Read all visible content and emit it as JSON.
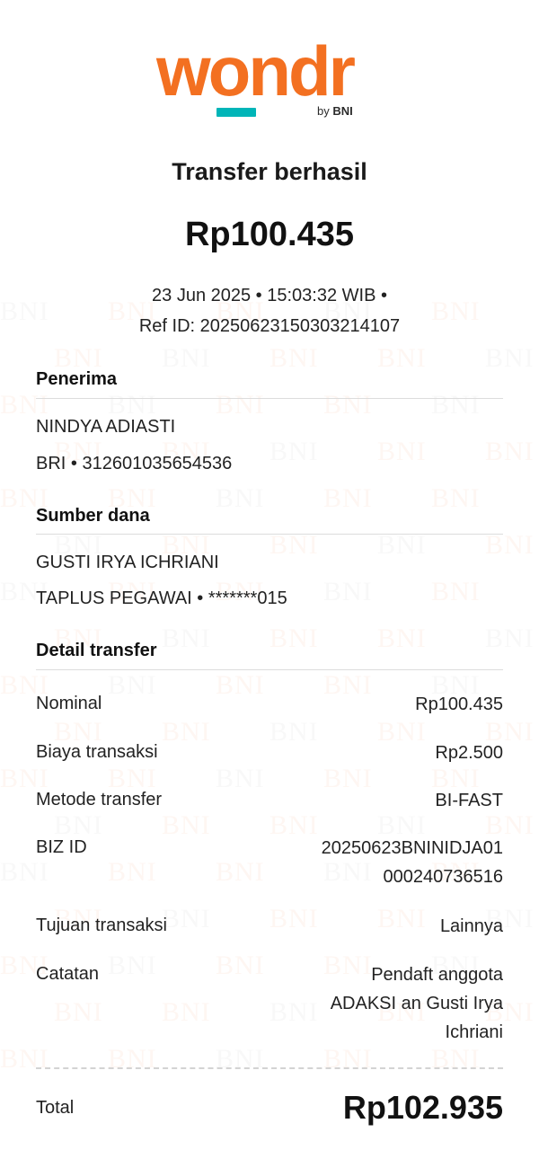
{
  "brand": {
    "logo_text": "wondr",
    "sub_prefix": "by",
    "sub_brand": "BNI",
    "colors": {
      "orange": "#f37021",
      "teal": "#00b5b8"
    }
  },
  "watermark_text": "BNI",
  "header": {
    "title": "Transfer berhasil",
    "amount": "Rp100.435",
    "datetime_line": "23 Jun 2025 • 15:03:32 WIB •",
    "ref_line": "Ref ID: 20250623150303214107"
  },
  "recipient": {
    "heading": "Penerima",
    "name": "NINDYA ADIASTI",
    "account": "BRI • 312601035654536"
  },
  "source": {
    "heading": "Sumber dana",
    "name": "GUSTI IRYA ICHRIANI",
    "account": "TAPLUS PEGAWAI • *******015"
  },
  "details": {
    "heading": "Detail transfer",
    "rows": [
      {
        "label": "Nominal",
        "value_lines": [
          "Rp100.435"
        ]
      },
      {
        "label": "Biaya transaksi",
        "value_lines": [
          "Rp2.500"
        ]
      },
      {
        "label": "Metode transfer",
        "value_lines": [
          "BI-FAST"
        ]
      },
      {
        "label": "BIZ ID",
        "value_lines": [
          "20250623BNINIDJA01",
          "000240736516"
        ]
      },
      {
        "label": "Tujuan transaksi",
        "value_lines": [
          "Lainnya"
        ]
      },
      {
        "label": "Catatan",
        "value_lines": [
          "Pendaft anggota",
          "ADAKSI an Gusti Irya",
          "Ichriani"
        ]
      }
    ]
  },
  "total": {
    "label": "Total",
    "value": "Rp102.935"
  }
}
